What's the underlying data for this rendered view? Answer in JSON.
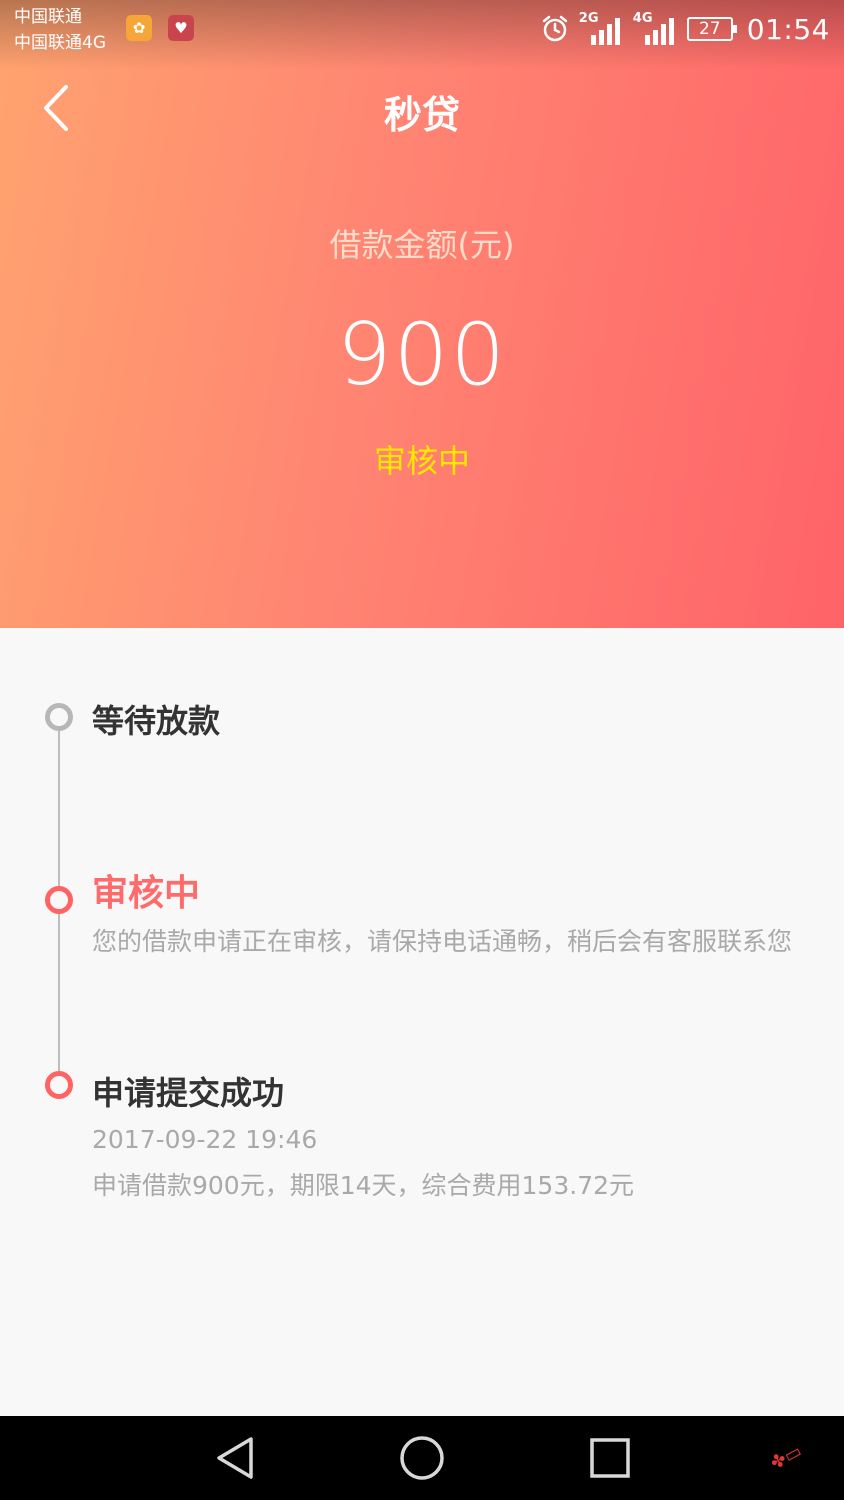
{
  "status_bar": {
    "carrier1": "中国联通",
    "carrier2": "中国联通4G",
    "net1": "2G",
    "net2": "4G",
    "battery": "27",
    "time": "01:54"
  },
  "header": {
    "title": "秒贷"
  },
  "loan": {
    "amount_label": "借款金额(元)",
    "amount": "900",
    "status": "审核中"
  },
  "timeline": {
    "step1": {
      "title": "等待放款"
    },
    "step2": {
      "title": "审核中",
      "desc": "您的借款申请正在审核，请保持电话通畅，稍后会有客服联系您"
    },
    "step3": {
      "title": "申请提交成功",
      "time": "2017-09-22 19:46",
      "desc": "申请借款900元，期限14天，综合费用153.72元"
    }
  },
  "colors": {
    "gradient_start": "#ffa36f",
    "gradient_end": "#ff6368",
    "active_red": "#ff6363",
    "status_yellow": "#ffe600"
  }
}
